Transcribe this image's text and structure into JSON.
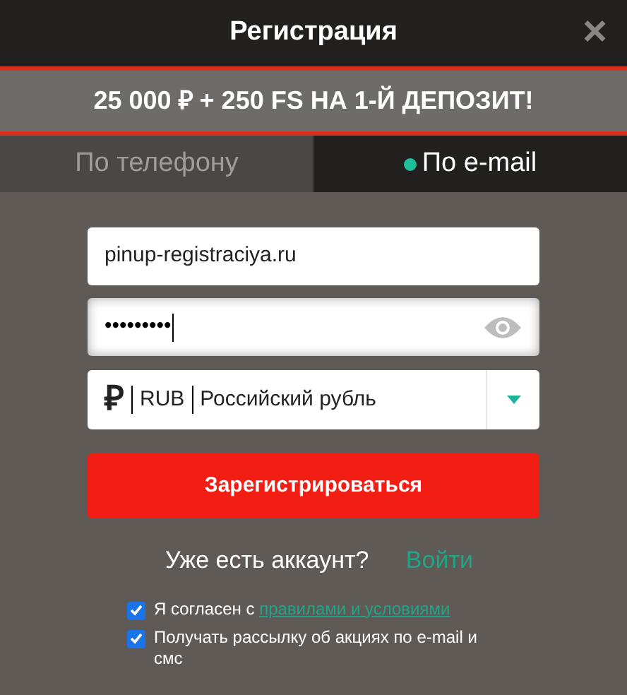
{
  "window": {
    "title": "Регистрация",
    "close": "×"
  },
  "banner": "25 000 ₽ + 250 FS НА 1-Й ДЕПОЗИТ!",
  "tabs": [
    {
      "label": "По телефону",
      "selected": false
    },
    {
      "label": "По e-mail",
      "selected": true
    }
  ],
  "email": {
    "value": "pinup-registraciya.ru"
  },
  "password": {
    "value": "•••••••••"
  },
  "currency": {
    "symbol": "₽",
    "code": "RUB",
    "name": "Российский рубль"
  },
  "submit": "Зарегистрироваться",
  "login": {
    "question": "Уже есть аккаунт?",
    "link": "Войти"
  },
  "consents": [
    {
      "text": "Я согласен с ",
      "link": "правилами и условиями",
      "checked": true
    },
    {
      "text": "Получать рассылку об акциях по e-mail и смс",
      "checked": true
    }
  ]
}
